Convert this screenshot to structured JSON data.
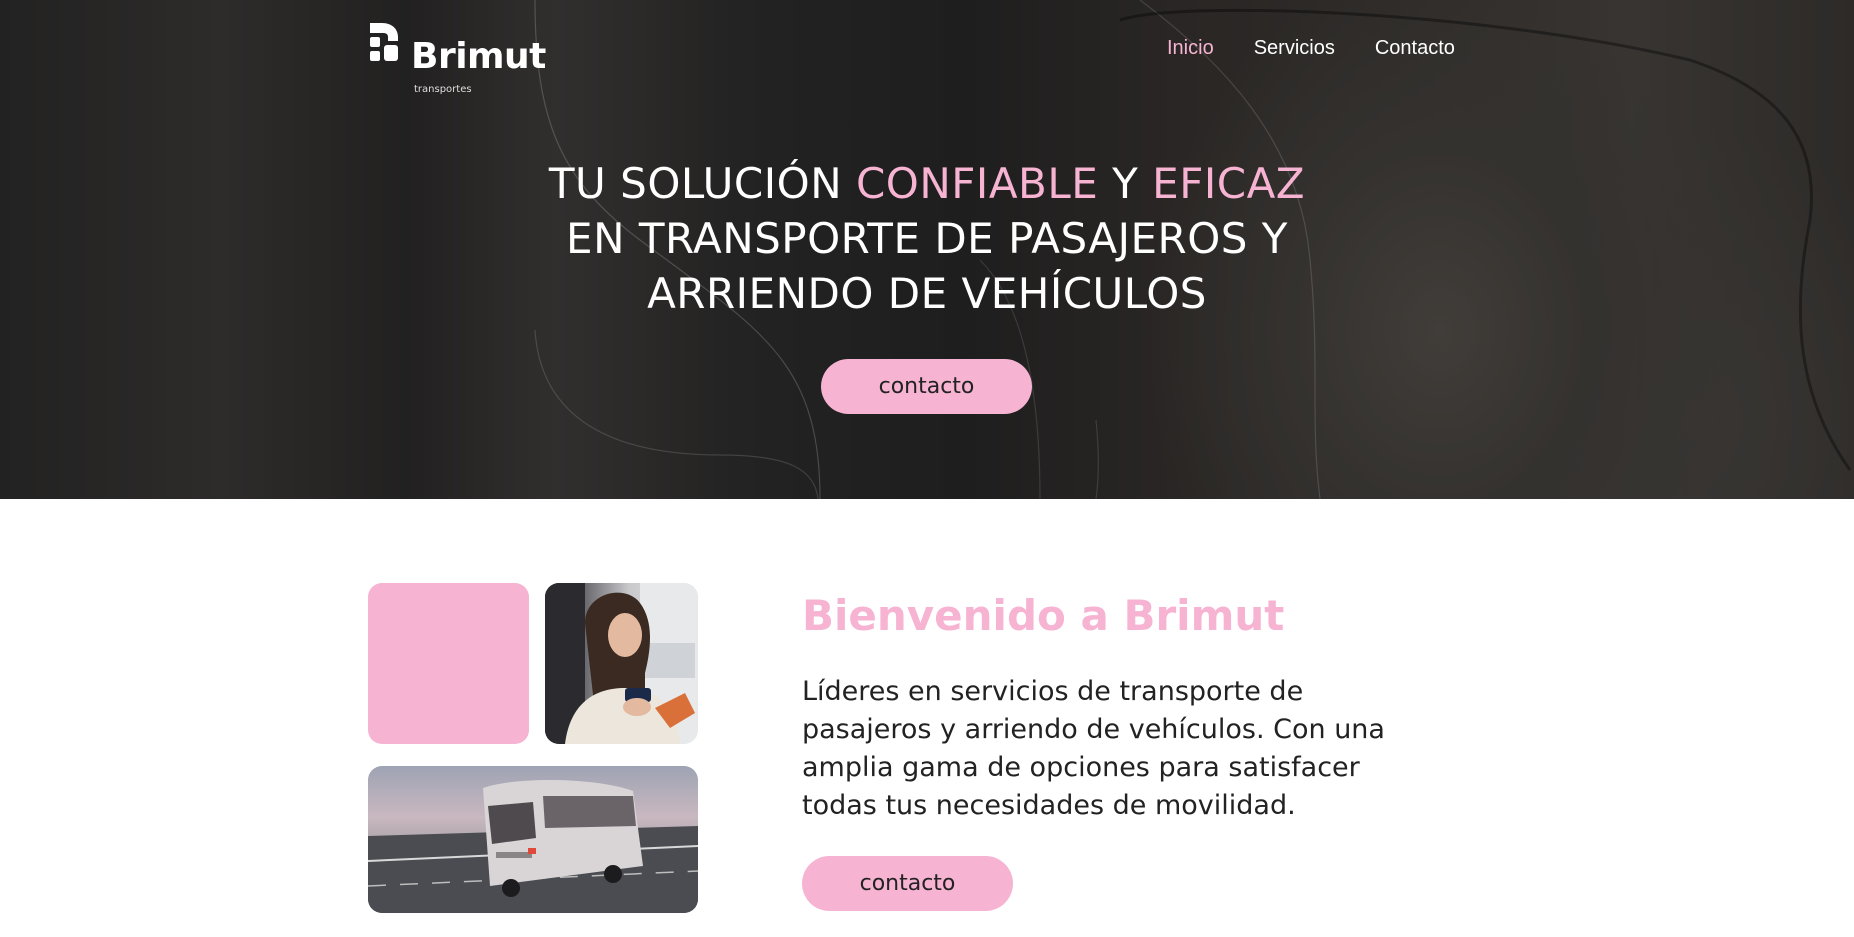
{
  "colors": {
    "accent": "#f7b3d2",
    "hero_text": "#ffffff",
    "body_text": "#222222"
  },
  "header": {
    "logo": {
      "name": "Brimut",
      "subtitle": "transportes"
    },
    "nav": [
      {
        "label": "Inicio",
        "active": true
      },
      {
        "label": "Servicios",
        "active": false
      },
      {
        "label": "Contacto",
        "active": false
      }
    ]
  },
  "hero": {
    "title_line1_prefix": "TU SOLUCIÓN ",
    "title_highlight1": "CONFIABLE",
    "title_line1_mid": " Y ",
    "title_highlight2": "EFICAZ",
    "title_line2": "EN TRANSPORTE DE PASAJEROS Y",
    "title_line3": "ARRIENDO DE VEHÍCULOS",
    "cta_label": "contacto"
  },
  "welcome": {
    "title": "Bienvenido a Brimut",
    "text": "Líderes en servicios de transporte de pasajeros y arriendo de vehículos. Con una amplia gama de opciones para satisfacer todas tus necesidades de movilidad.",
    "cta_label": "contacto",
    "images": [
      {
        "name": "pink-tile"
      },
      {
        "name": "woman-with-phone-photo"
      },
      {
        "name": "bus-on-highway-photo"
      }
    ]
  }
}
